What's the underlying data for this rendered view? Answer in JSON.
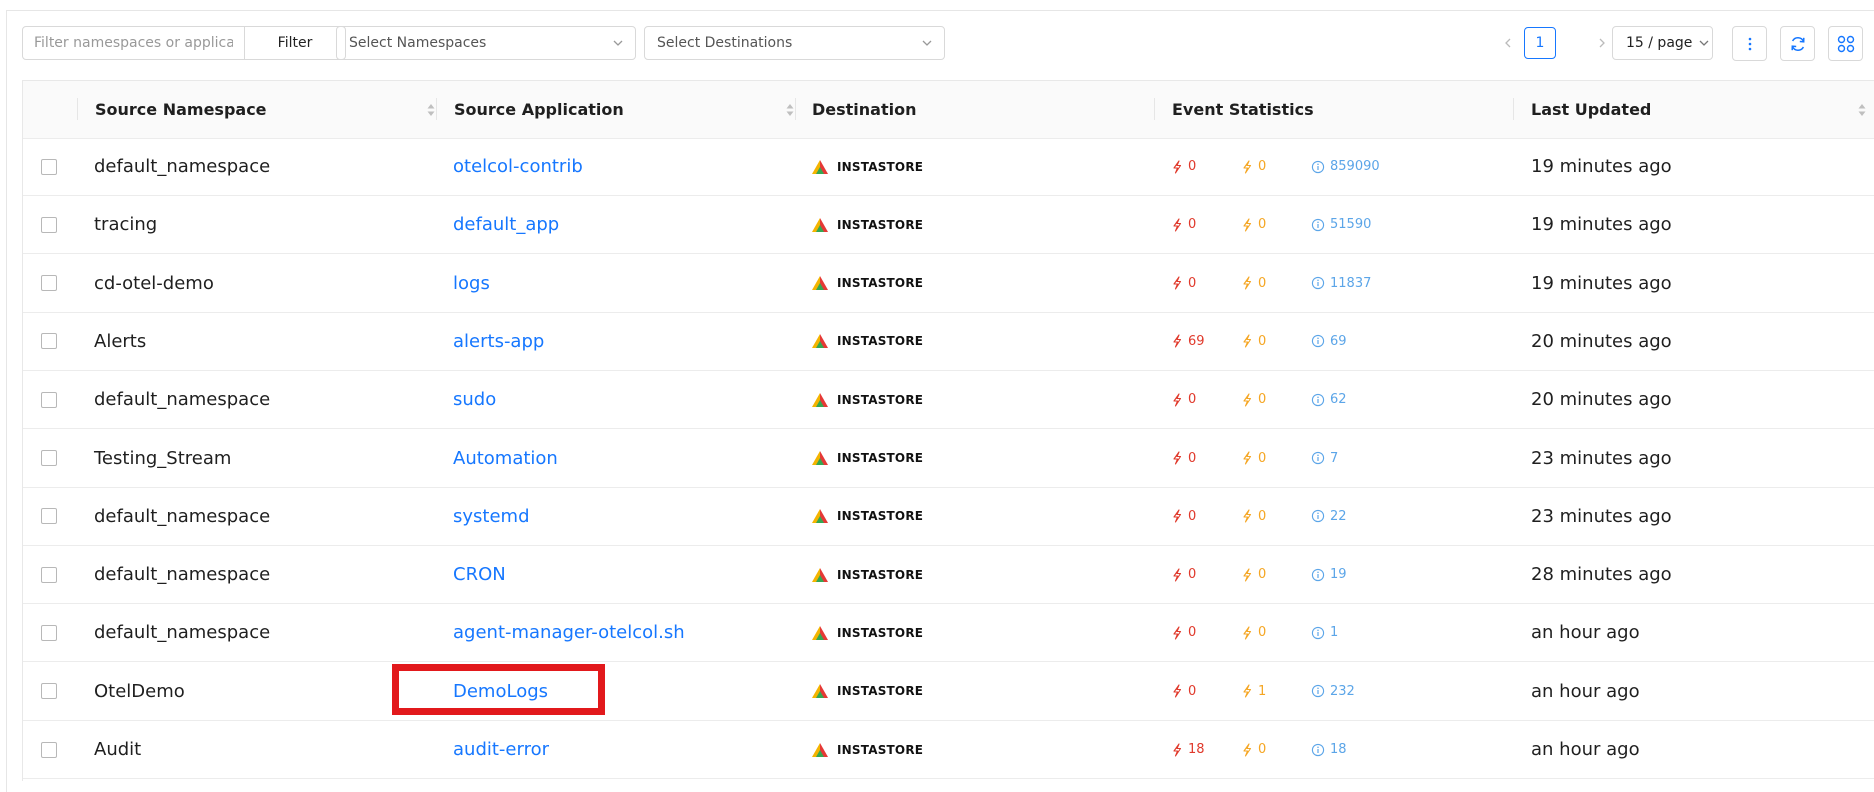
{
  "toolbar": {
    "filter_placeholder": "Filter namespaces or applications",
    "filter_button": "Filter",
    "namespaces_placeholder": "Select Namespaces",
    "destinations_placeholder": "Select Destinations"
  },
  "pagination": {
    "current_page": "1",
    "page_size": "15 / page"
  },
  "columns": {
    "source_namespace": "Source Namespace",
    "source_application": "Source Application",
    "destination": "Destination",
    "event_statistics": "Event Statistics",
    "last_updated": "Last Updated"
  },
  "rows": [
    {
      "namespace": "default_namespace",
      "application": "otelcol-contrib",
      "destination": "INSTASTORE",
      "errors": "0",
      "warnings": "0",
      "info": "859090",
      "updated": "19 minutes ago"
    },
    {
      "namespace": "tracing",
      "application": "default_app",
      "destination": "INSTASTORE",
      "errors": "0",
      "warnings": "0",
      "info": "51590",
      "updated": "19 minutes ago"
    },
    {
      "namespace": "cd-otel-demo",
      "application": "logs",
      "destination": "INSTASTORE",
      "errors": "0",
      "warnings": "0",
      "info": "11837",
      "updated": "19 minutes ago"
    },
    {
      "namespace": "Alerts",
      "application": "alerts-app",
      "destination": "INSTASTORE",
      "errors": "69",
      "warnings": "0",
      "info": "69",
      "updated": "20 minutes ago"
    },
    {
      "namespace": "default_namespace",
      "application": "sudo",
      "destination": "INSTASTORE",
      "errors": "0",
      "warnings": "0",
      "info": "62",
      "updated": "20 minutes ago"
    },
    {
      "namespace": "Testing_Stream",
      "application": "Automation",
      "destination": "INSTASTORE",
      "errors": "0",
      "warnings": "0",
      "info": "7",
      "updated": "23 minutes ago"
    },
    {
      "namespace": "default_namespace",
      "application": "systemd",
      "destination": "INSTASTORE",
      "errors": "0",
      "warnings": "0",
      "info": "22",
      "updated": "23 minutes ago"
    },
    {
      "namespace": "default_namespace",
      "application": "CRON",
      "destination": "INSTASTORE",
      "errors": "0",
      "warnings": "0",
      "info": "19",
      "updated": "28 minutes ago"
    },
    {
      "namespace": "default_namespace",
      "application": "agent-manager-otelcol.sh",
      "destination": "INSTASTORE",
      "errors": "0",
      "warnings": "0",
      "info": "1",
      "updated": "an hour ago"
    },
    {
      "namespace": "OtelDemo",
      "application": "DemoLogs",
      "destination": "INSTASTORE",
      "errors": "0",
      "warnings": "1",
      "info": "232",
      "updated": "an hour ago"
    },
    {
      "namespace": "Audit",
      "application": "audit-error",
      "destination": "INSTASTORE",
      "errors": "18",
      "warnings": "0",
      "info": "18",
      "updated": "an hour ago"
    }
  ],
  "colors": {
    "link": "#1677ff",
    "error": "#e0392b",
    "warning": "#f5a623",
    "info": "#5ba5e8",
    "highlight": "#e2191c"
  },
  "icons": [
    "chevron-down-icon",
    "chevron-left-icon",
    "chevron-right-icon",
    "more-vertical-icon",
    "refresh-icon",
    "apps-grid-icon",
    "sort-icon",
    "error-bolt-icon",
    "warning-bolt-icon",
    "info-circle-icon",
    "instastore-logo-icon"
  ]
}
